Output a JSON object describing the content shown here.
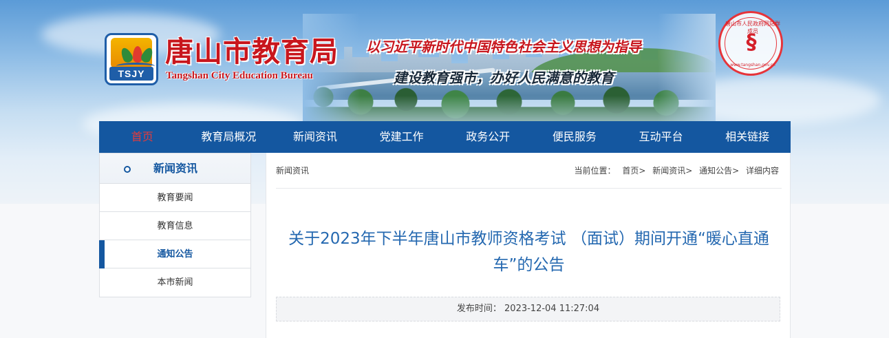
{
  "header": {
    "logo_text": "TSJY",
    "title": "唐山市教育局",
    "subtitle": "Tangshan City Education Bureau",
    "slogan_primary": "以习近平新时代中国特色社会主义思想为指导",
    "slogan_secondary": "建设教育强市，办好人民满意的教育",
    "seal": {
      "name": "唐山市人民政府网站群成员",
      "url": "www.tangshan.gov.cn"
    }
  },
  "nav": {
    "items": [
      {
        "label": "首页",
        "active": true
      },
      {
        "label": "教育局概况"
      },
      {
        "label": "新闻资讯"
      },
      {
        "label": "党建工作"
      },
      {
        "label": "政务公开"
      },
      {
        "label": "便民服务"
      },
      {
        "label": "互动平台"
      },
      {
        "label": "相关链接"
      }
    ]
  },
  "sidebar": {
    "title": "新闻资讯",
    "items": [
      {
        "label": "教育要闻"
      },
      {
        "label": "教育信息"
      },
      {
        "label": "通知公告",
        "active": true
      },
      {
        "label": "本市新闻"
      }
    ]
  },
  "main": {
    "section_title": "新闻资讯",
    "breadcrumb": {
      "prefix": "当前位置：",
      "items": [
        "首页>",
        "新闻资讯>",
        "通知公告>",
        "详细内容"
      ]
    },
    "article": {
      "title": "关于2023年下半年唐山市教师资格考试 （面试）期间开通“暖心直通车”的公告",
      "publish_label": "发布时间：",
      "publish_time": "2023-12-04 11:27:04"
    }
  },
  "colors": {
    "nav_bg": "#1457a0",
    "nav_active": "#e43b3b",
    "title_red": "#c8161d",
    "article_title": "#2468b0"
  }
}
